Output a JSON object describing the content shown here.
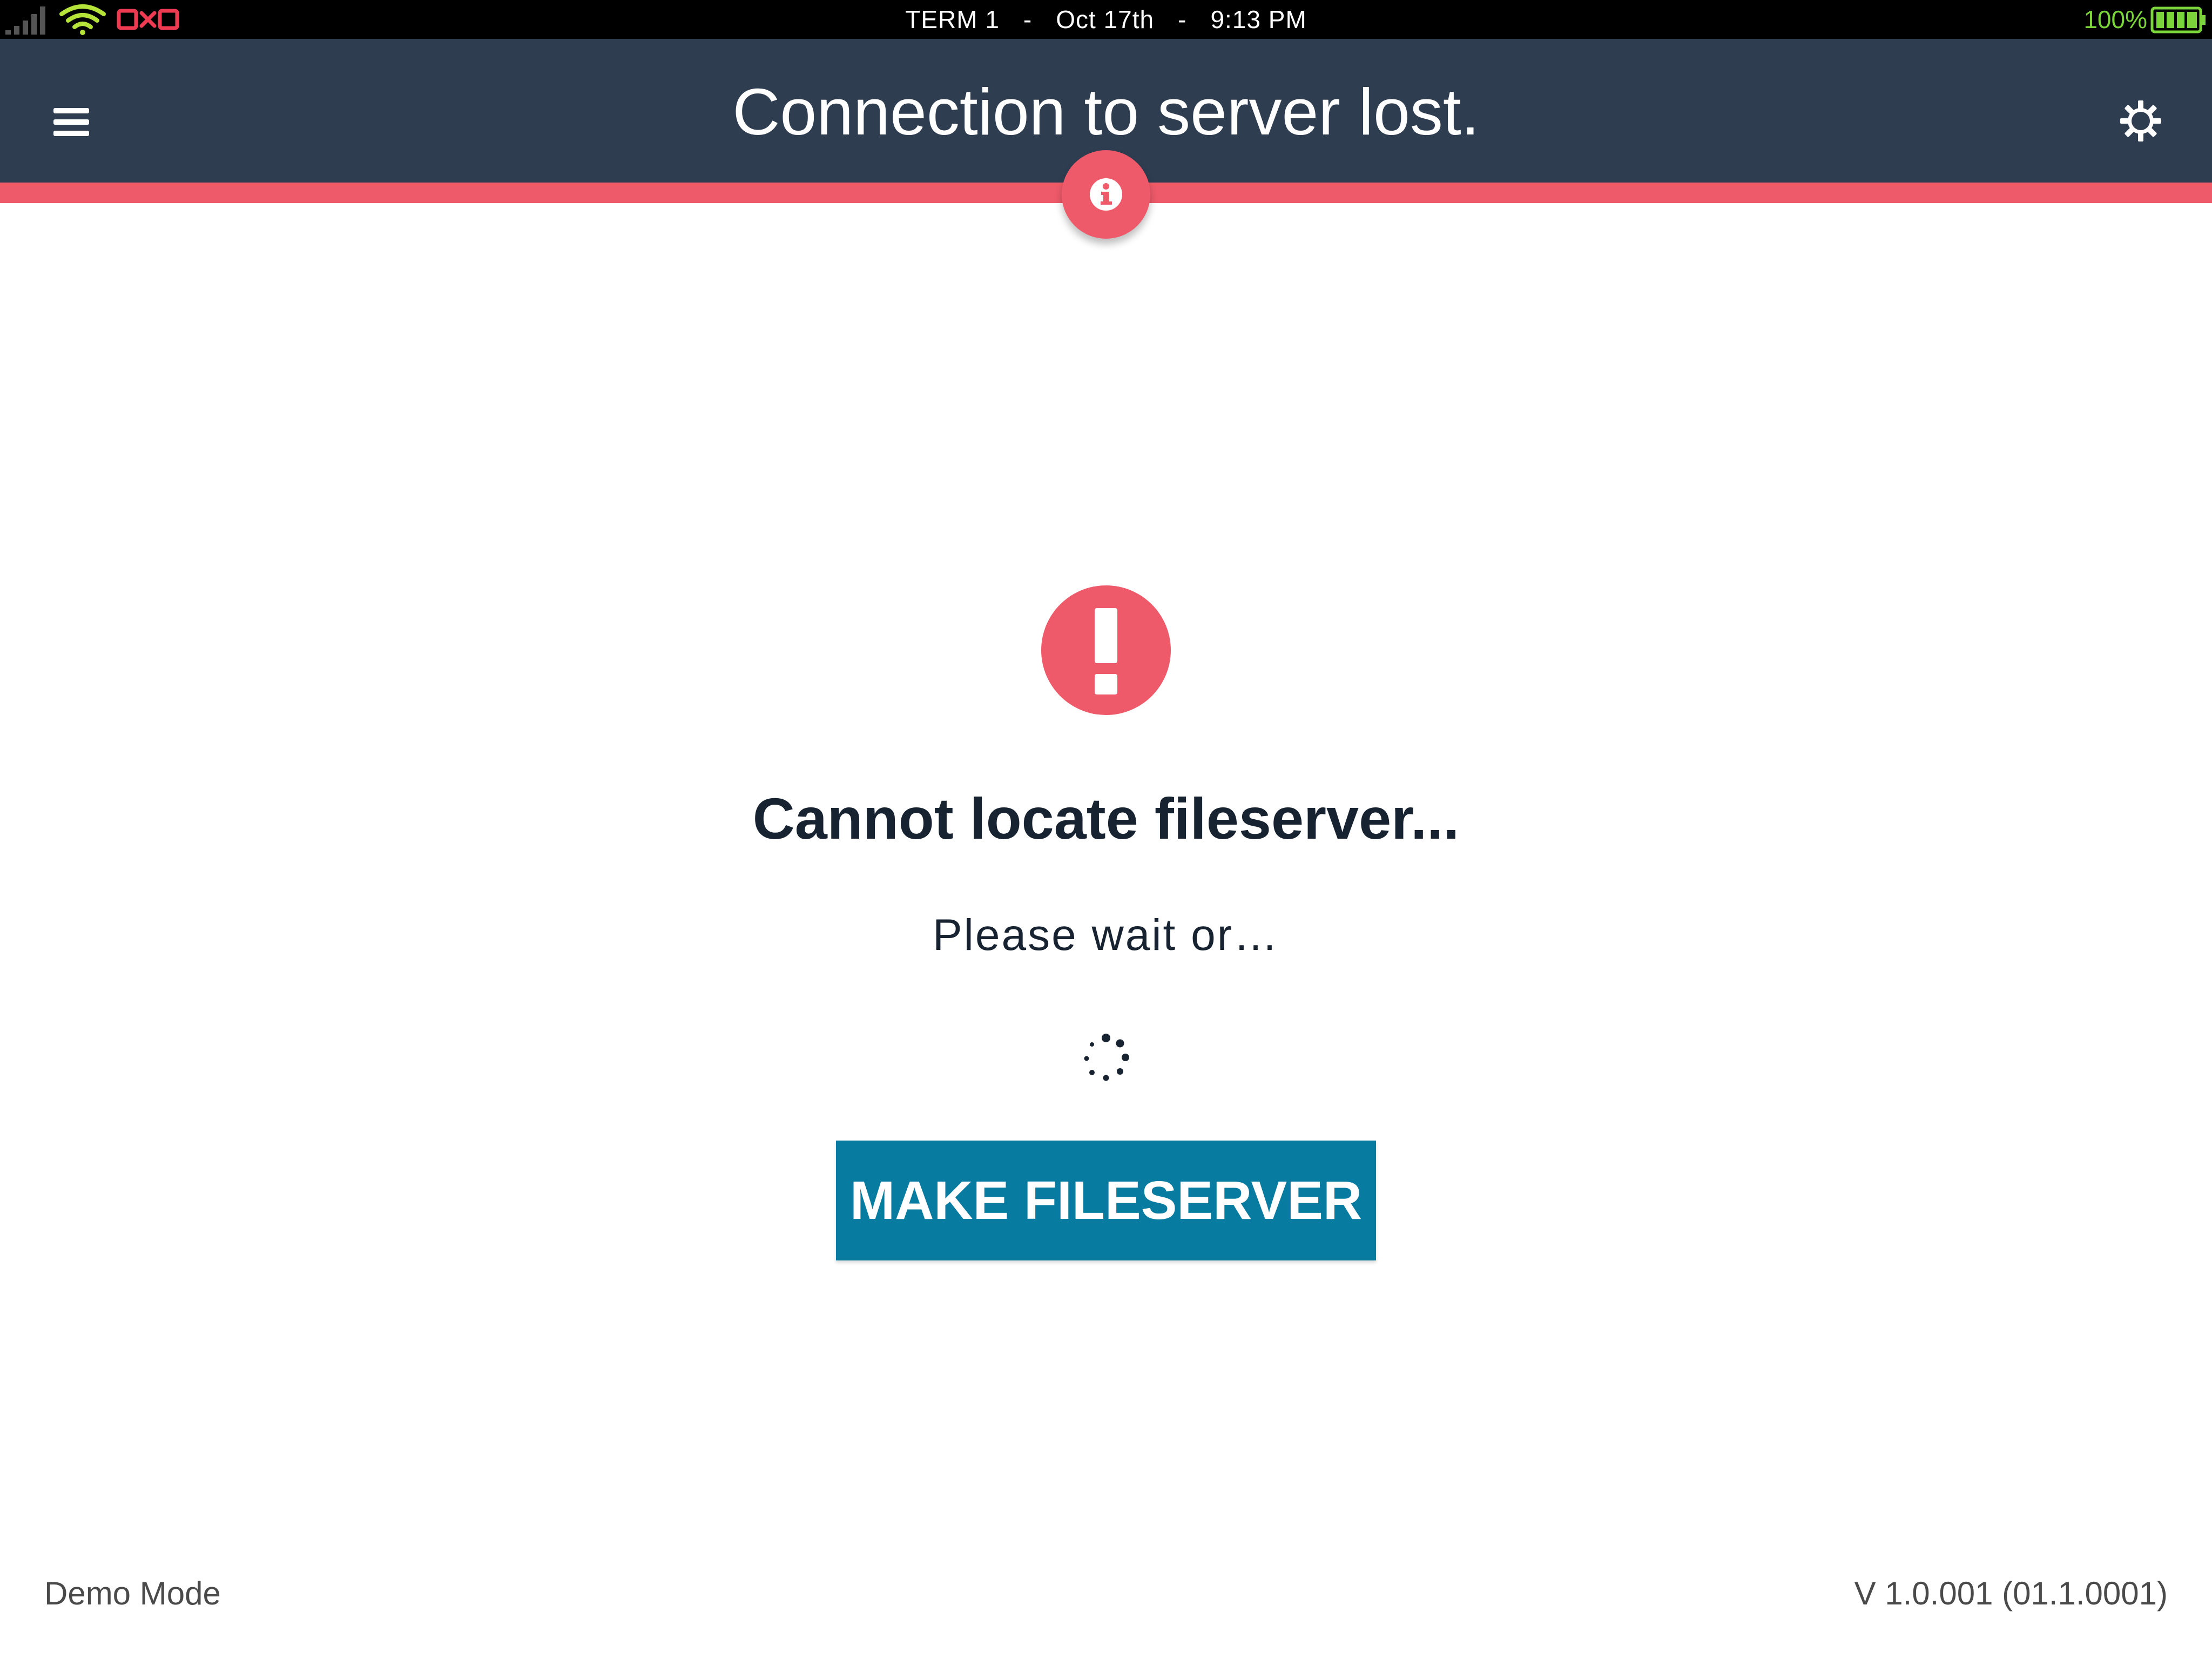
{
  "status_bar": {
    "brand": "OXO",
    "terminal": "TERM 1",
    "separator": "-",
    "date": "Oct 17th",
    "time": "9:13 PM",
    "battery": "100%",
    "colors": {
      "brand": "#ee3b52",
      "wifi": "#b6e33a",
      "battery": "#7bd53a"
    }
  },
  "header": {
    "title": "Connection to server lost.",
    "menu_icon": "hamburger-menu-icon",
    "settings_icon": "gear-icon",
    "info_icon": "info-icon",
    "colors": {
      "background": "#2f3d51",
      "alert": "#ee5a69"
    }
  },
  "main": {
    "error_icon": "exclamation-icon",
    "headline": "Cannot locate fileserver...",
    "subline": "Please wait or…",
    "spinner_icon": "loading-spinner-icon",
    "button_label": "MAKE FILESERVER",
    "colors": {
      "button": "#087ba0",
      "error": "#ee5a69"
    }
  },
  "footer": {
    "mode": "Demo Mode",
    "version": "V 1.0.001 (01.1.0001)"
  }
}
